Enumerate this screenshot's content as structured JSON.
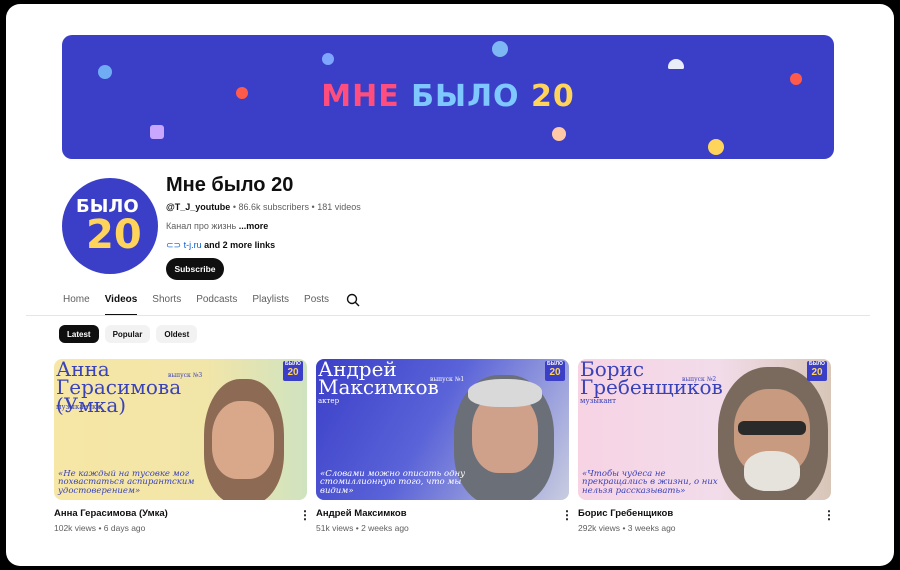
{
  "banner": {
    "title_part1": "МНЕ ",
    "title_part2": "БЫЛО ",
    "title_part3": "20"
  },
  "channel": {
    "avatar_line1": "БЫЛО",
    "avatar_line2": "20",
    "name": "Мне было 20",
    "handle": "@T_J_youtube",
    "subscribers": "86.6k subscribers",
    "videos": "181 videos",
    "separator": "•",
    "description": "Канал про жизнь",
    "more": "...more",
    "link": "t-j.ru",
    "more_links": "and 2 more links",
    "subscribe_label": "Subscribe"
  },
  "tabs": [
    "Home",
    "Videos",
    "Shorts",
    "Podcasts",
    "Playlists",
    "Posts"
  ],
  "chips": [
    "Latest",
    "Popular",
    "Oldest"
  ],
  "videos": [
    {
      "thumb_name": "Анна Герасимова (Умка)",
      "thumb_role": "музыкантка",
      "thumb_episode": "выпуск №3",
      "thumb_quote": "«Не каждый на тусовке мог похвастаться аспирантским удостоверением»",
      "title": "Анна Герасимова (Умка)",
      "views": "102k views",
      "age": "6 days ago",
      "color_bg": "#f6e7a6",
      "color_text": "#3a42b8"
    },
    {
      "thumb_name": "Андрей Максимков",
      "thumb_role": "актер",
      "thumb_episode": "выпуск №1",
      "thumb_quote": "«Словами можно описать одну стомиллионную того, что мы видим»",
      "title": "Андрей Максимков",
      "views": "51k views",
      "age": "2 weeks ago",
      "color_bg": "#3b3fc8",
      "color_text": "#ffffff"
    },
    {
      "thumb_name": "Борис Гребенщиков",
      "thumb_role": "музыкант",
      "thumb_episode": "выпуск №2",
      "thumb_quote": "«Чтобы чудеса не прекращались в жизни, о них нельзя рассказывать»",
      "title": "Борис Гребенщиков",
      "views": "292k views",
      "age": "3 weeks ago",
      "color_bg": "#f7d3e4",
      "color_text": "#3a42b8"
    }
  ],
  "logo_small": {
    "line1": "БЫЛО",
    "line2": "20"
  },
  "icons": {
    "search": "search-icon",
    "kebab": "more-vert-icon",
    "link": "link-icon"
  }
}
